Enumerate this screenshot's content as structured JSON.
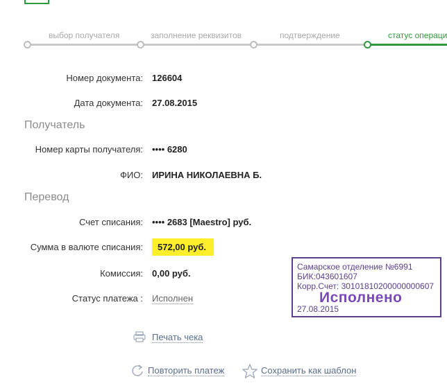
{
  "stepper": {
    "steps": [
      {
        "label": "выбор получателя"
      },
      {
        "label": "заполнение реквизитов"
      },
      {
        "label": "подтверждение"
      },
      {
        "label": "статус операции"
      }
    ]
  },
  "details": {
    "doc_number_label": "Номер документа:",
    "doc_number_value": "126604",
    "doc_date_label": "Дата документа:",
    "doc_date_value": "27.08.2015"
  },
  "recipient": {
    "title": "Получатель",
    "card_label": "Номер карты получателя:",
    "card_value": "•••• 6280",
    "name_label": "ФИО:",
    "name_value": "ИРИНА НИКОЛАЕВНА Б."
  },
  "transfer": {
    "title": "Перевод",
    "account_label": "Счет списания:",
    "account_value": "•••• 2683  [Maestro]  руб.",
    "amount_label": "Сумма в валюте списания:",
    "amount_value": "572,00  руб.",
    "fee_label": "Комиссия:",
    "fee_value": "0,00 руб.",
    "status_label": "Статус платежа :",
    "status_value": "Исполнен"
  },
  "stamp": {
    "line1": "Самарское отделение №6991",
    "line2": "БИК:043601607",
    "line3": "Корр.Счет: 30101810200000000607",
    "status": "Исполнено",
    "date": "27.08.2015"
  },
  "actions": {
    "print": "Печать чека",
    "repeat": "Повторить платеж",
    "save_template": "Сохранить как шаблон"
  },
  "colors": {
    "accent_green": "#2e9a3c",
    "highlight_yellow": "#ffef2b",
    "stamp_purple": "#5b3f8f"
  }
}
